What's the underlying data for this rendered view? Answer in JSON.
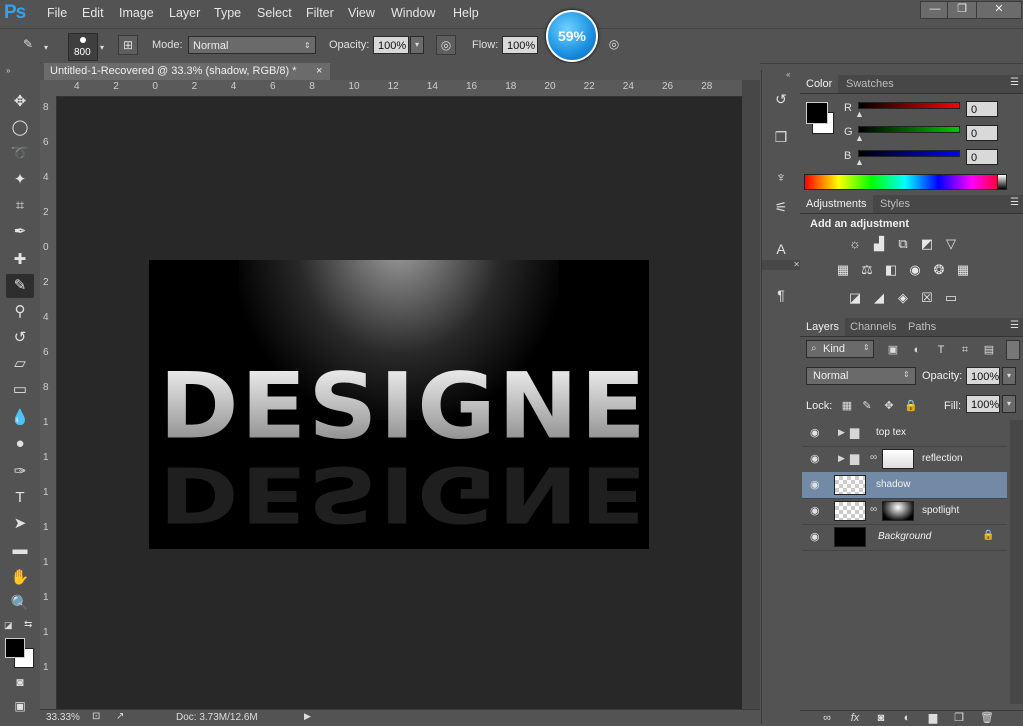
{
  "app": {
    "logo": "Ps"
  },
  "menu": [
    "File",
    "Edit",
    "Image",
    "Layer",
    "Type",
    "Select",
    "Filter",
    "View",
    "Window",
    "Help"
  ],
  "window_buttons": {
    "minimize": "—",
    "restore": "❐",
    "close": "✕"
  },
  "options": {
    "brush_size": "800",
    "mode_label": "Mode:",
    "mode_value": "Normal",
    "opacity_label": "Opacity:",
    "opacity_value": "100%",
    "flow_label": "Flow:",
    "flow_value": "100%",
    "zoom_badge": "59%"
  },
  "document": {
    "tab_title": "Untitled-1-Recovered @ 33.3% (shadow, RGB/8) *",
    "close": "×",
    "main_text": "DESIGNER",
    "ruler_top": [
      "4",
      "2",
      "0",
      "2",
      "4",
      "6",
      "8",
      "10",
      "12",
      "14",
      "16",
      "18",
      "20",
      "22",
      "24",
      "26",
      "28"
    ],
    "ruler_left": [
      "8",
      "6",
      "4",
      "2",
      "0",
      "2",
      "4",
      "6",
      "8",
      "1",
      "1",
      "1",
      "1",
      "1",
      "1",
      "1",
      "1"
    ]
  },
  "status": {
    "zoom": "33.33%",
    "doc": "Doc: 3.73M/12.6M"
  },
  "color_panel": {
    "tabs": [
      "Color",
      "Swatches"
    ],
    "channels": [
      {
        "label": "R",
        "value": "0",
        "color": "#ff0000"
      },
      {
        "label": "G",
        "value": "0",
        "color": "#00c800"
      },
      {
        "label": "B",
        "value": "0",
        "color": "#0000ff"
      }
    ]
  },
  "adjustments_panel": {
    "tabs": [
      "Adjustments",
      "Styles"
    ],
    "title": "Add an adjustment"
  },
  "layers_panel": {
    "tabs": [
      "Layers",
      "Channels",
      "Paths"
    ],
    "kind": "Kind",
    "blend_mode": "Normal",
    "opacity_label": "Opacity:",
    "opacity_value": "100%",
    "lock_label": "Lock:",
    "fill_label": "Fill:",
    "fill_value": "100%",
    "layers": [
      {
        "name": "top tex",
        "type": "group"
      },
      {
        "name": "reflection",
        "type": "group-mask"
      },
      {
        "name": "shadow",
        "type": "layer",
        "selected": true
      },
      {
        "name": "spotlight",
        "type": "layer-mask"
      },
      {
        "name": "Background",
        "type": "background",
        "locked": true
      }
    ],
    "bottom_buttons": [
      "link-icon",
      "fx-icon",
      "mask-icon",
      "adjustment-icon",
      "folder-icon",
      "new-layer-icon",
      "trash-icon"
    ]
  },
  "colors": {
    "accent": "#2fa3f2",
    "selected_layer": "#728aa6",
    "panel_bg": "#535353"
  }
}
